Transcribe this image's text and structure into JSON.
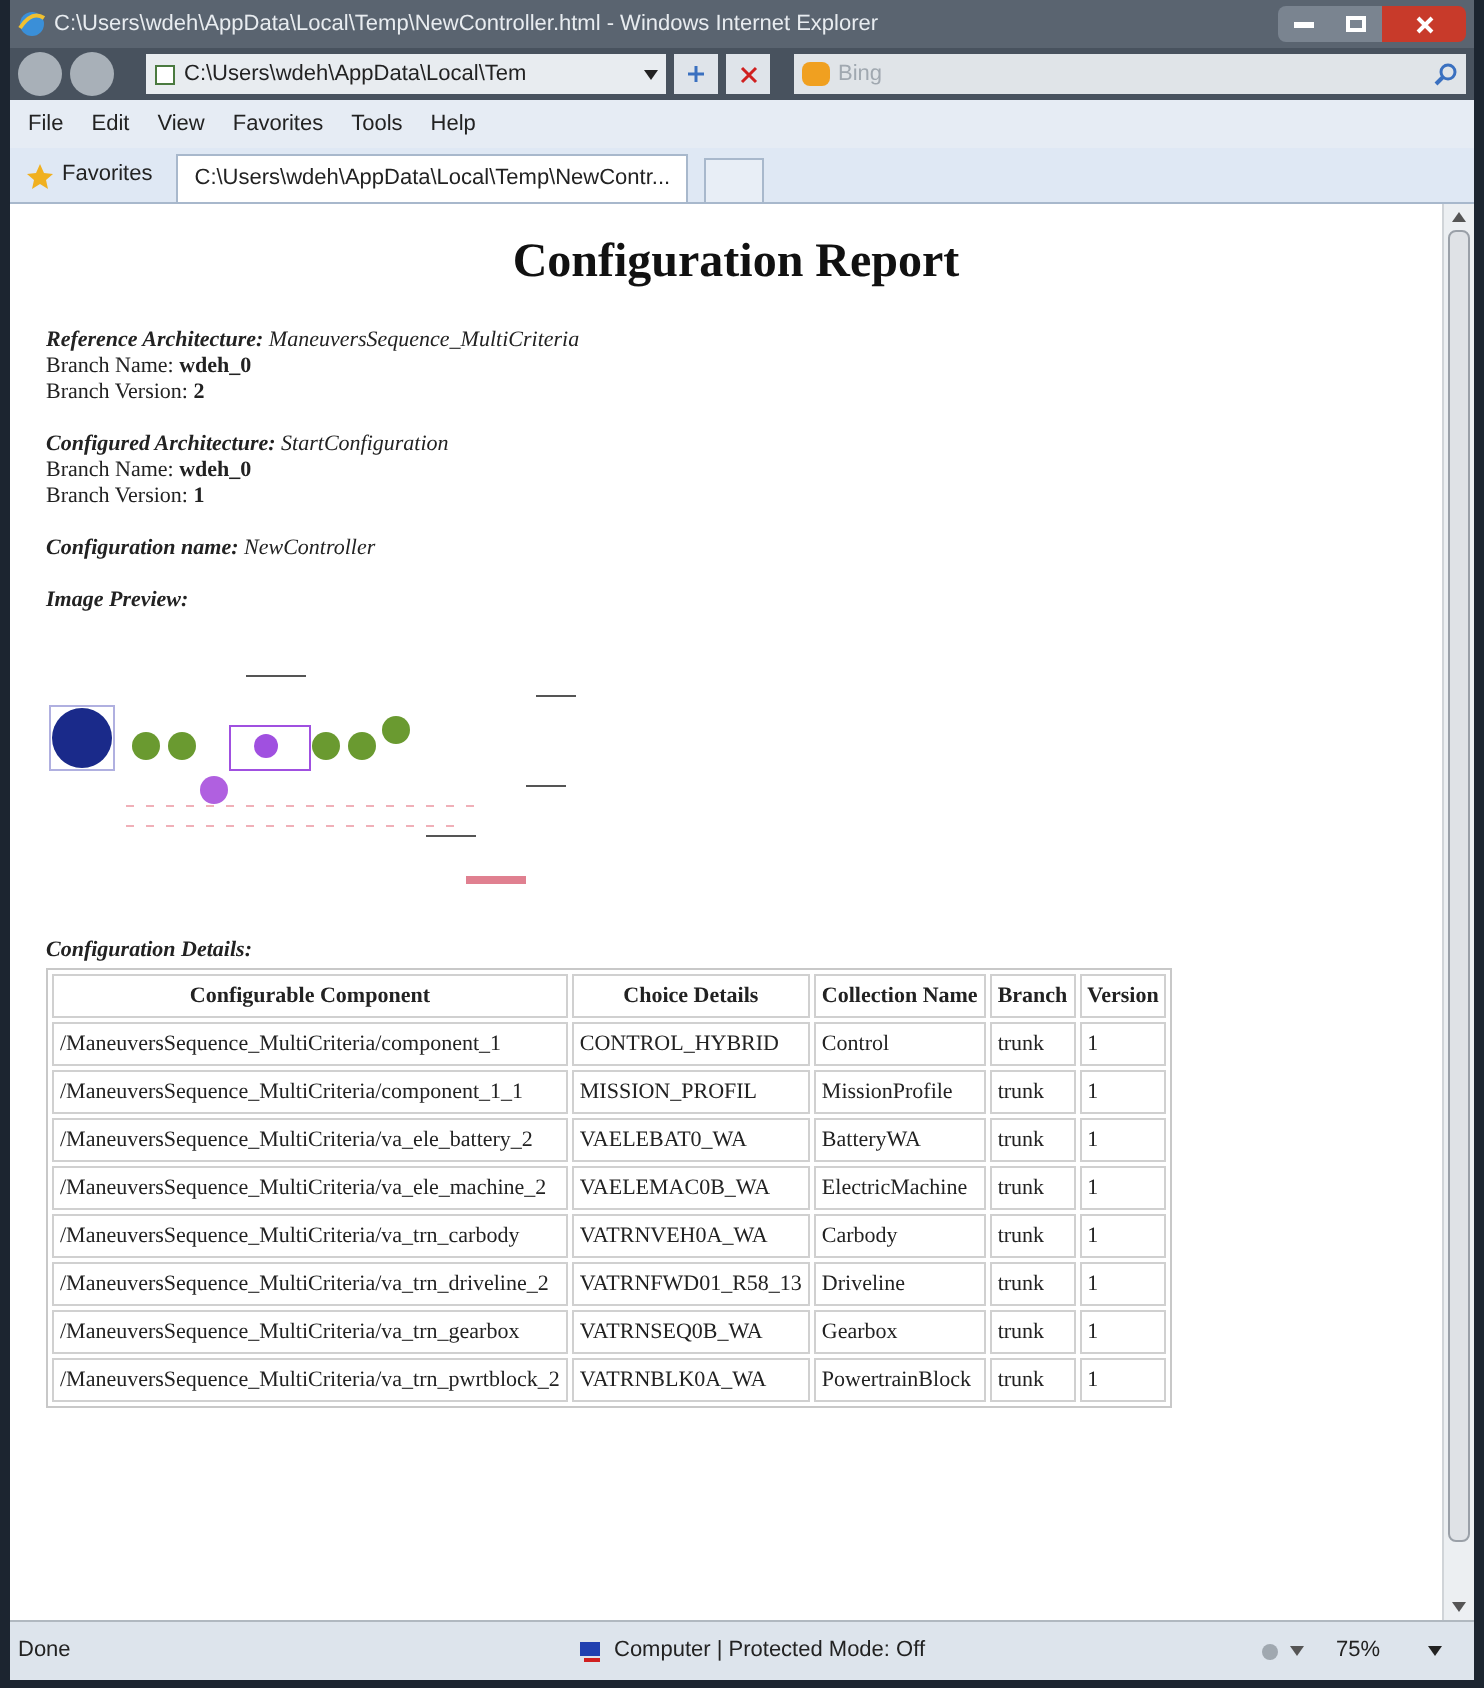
{
  "window": {
    "title": "C:\\Users\\wdeh\\AppData\\Local\\Temp\\NewController.html - Windows Internet Explorer"
  },
  "address_bar": {
    "value": "C:\\Users\\wdeh\\AppData\\Local\\Tem"
  },
  "search": {
    "placeholder": "Bing"
  },
  "menu": [
    "File",
    "Edit",
    "View",
    "Favorites",
    "Tools",
    "Help"
  ],
  "favorites_label": "Favorites",
  "tabs": [
    {
      "label": "C:\\Users\\wdeh\\AppData\\Local\\Temp\\NewContr...",
      "selected": true
    }
  ],
  "page": {
    "title": "Configuration Report",
    "sections": [
      {
        "label": "Reference Architecture:",
        "value": "ManeuversSequence_MultiCriteria",
        "lines": [
          {
            "label": "Branch Name:",
            "value": "wdeh_0"
          },
          {
            "label": "Branch Version:",
            "value": "2"
          }
        ]
      },
      {
        "label": "Configured Architecture:",
        "value": "StartConfiguration",
        "lines": [
          {
            "label": "Branch Name:",
            "value": "wdeh_0"
          },
          {
            "label": "Branch Version:",
            "value": "1"
          }
        ]
      },
      {
        "label": "Configuration name:",
        "value": "NewController"
      }
    ],
    "image_preview_label": "Image Preview:",
    "details_label": "Configuration Details:",
    "table": {
      "columns": [
        "Configurable Component",
        "Choice Details",
        "Collection Name",
        "Branch",
        "Version"
      ],
      "rows": [
        [
          "/ManeuversSequence_MultiCriteria/component_1",
          "CONTROL_HYBRID",
          "Control",
          "trunk",
          "1"
        ],
        [
          "/ManeuversSequence_MultiCriteria/component_1_1",
          "MISSION_PROFIL",
          "MissionProfile",
          "trunk",
          "1"
        ],
        [
          "/ManeuversSequence_MultiCriteria/va_ele_battery_2",
          "VAELEBAT0_WA",
          "BatteryWA",
          "trunk",
          "1"
        ],
        [
          "/ManeuversSequence_MultiCriteria/va_ele_machine_2",
          "VAELEMAC0B_WA",
          "ElectricMachine",
          "trunk",
          "1"
        ],
        [
          "/ManeuversSequence_MultiCriteria/va_trn_carbody",
          "VATRNVEH0A_WA",
          "Carbody",
          "trunk",
          "1"
        ],
        [
          "/ManeuversSequence_MultiCriteria/va_trn_driveline_2",
          "VATRNFWD01_R58_13",
          "Driveline",
          "trunk",
          "1"
        ],
        [
          "/ManeuversSequence_MultiCriteria/va_trn_gearbox",
          "VATRNSEQ0B_WA",
          "Gearbox",
          "trunk",
          "1"
        ],
        [
          "/ManeuversSequence_MultiCriteria/va_trn_pwrtblock_2",
          "VATRNBLK0A_WA",
          "PowertrainBlock",
          "trunk",
          "1"
        ]
      ]
    }
  },
  "status_bar": {
    "status": "Done",
    "zone": "Computer | Protected Mode: Off",
    "zoom": "75%"
  }
}
